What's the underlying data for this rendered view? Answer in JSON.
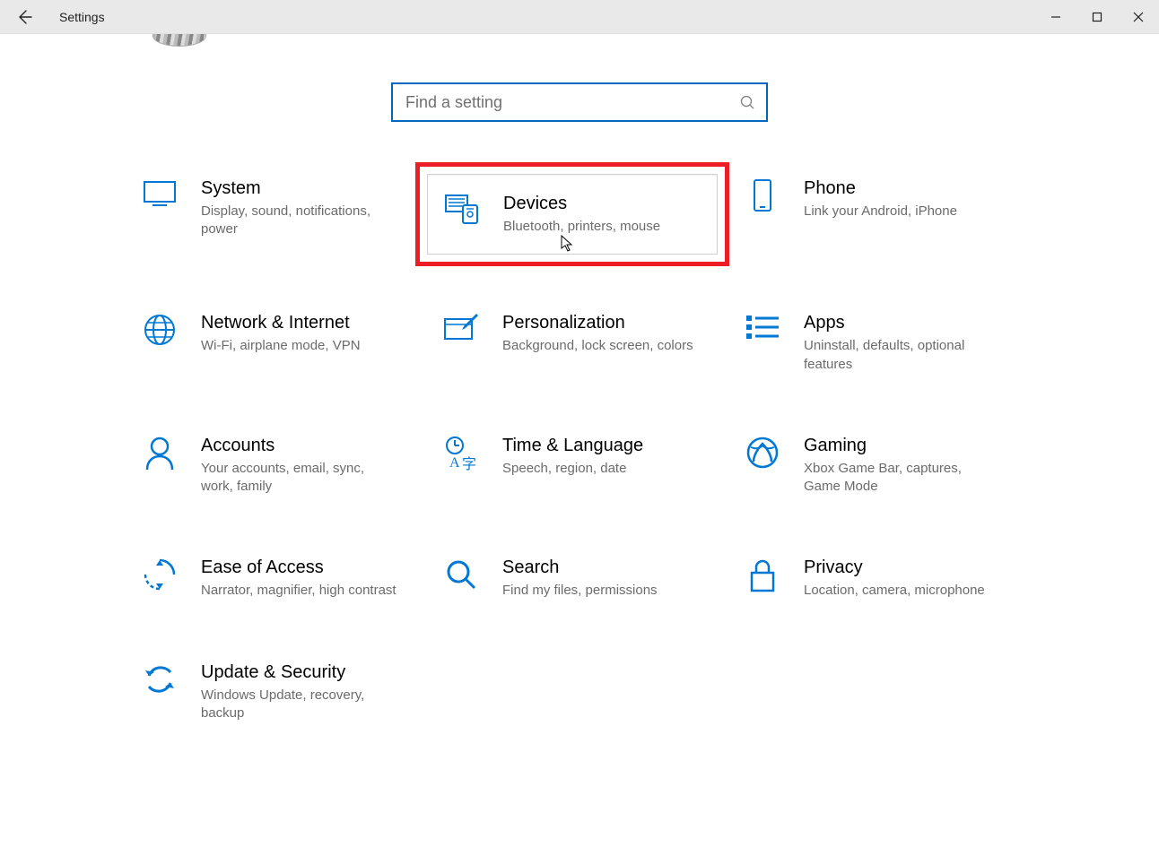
{
  "window": {
    "title": "Settings"
  },
  "search": {
    "placeholder": "Find a setting"
  },
  "colors": {
    "accent": "#0067c0",
    "highlight": "#ee1c25",
    "icon": "#0078d4"
  },
  "tiles": [
    {
      "id": "system",
      "title": "System",
      "desc": "Display, sound, notifications, power"
    },
    {
      "id": "devices",
      "title": "Devices",
      "desc": "Bluetooth, printers, mouse"
    },
    {
      "id": "phone",
      "title": "Phone",
      "desc": "Link your Android, iPhone"
    },
    {
      "id": "network",
      "title": "Network & Internet",
      "desc": "Wi-Fi, airplane mode, VPN"
    },
    {
      "id": "personalization",
      "title": "Personalization",
      "desc": "Background, lock screen, colors"
    },
    {
      "id": "apps",
      "title": "Apps",
      "desc": "Uninstall, defaults, optional features"
    },
    {
      "id": "accounts",
      "title": "Accounts",
      "desc": "Your accounts, email, sync, work, family"
    },
    {
      "id": "time",
      "title": "Time & Language",
      "desc": "Speech, region, date"
    },
    {
      "id": "gaming",
      "title": "Gaming",
      "desc": "Xbox Game Bar, captures, Game Mode"
    },
    {
      "id": "ease",
      "title": "Ease of Access",
      "desc": "Narrator, magnifier, high contrast"
    },
    {
      "id": "searchcat",
      "title": "Search",
      "desc": "Find my files, permissions"
    },
    {
      "id": "privacy",
      "title": "Privacy",
      "desc": "Location, camera, microphone"
    },
    {
      "id": "update",
      "title": "Update & Security",
      "desc": "Windows Update, recovery, backup"
    }
  ],
  "highlighted_tile": "devices"
}
